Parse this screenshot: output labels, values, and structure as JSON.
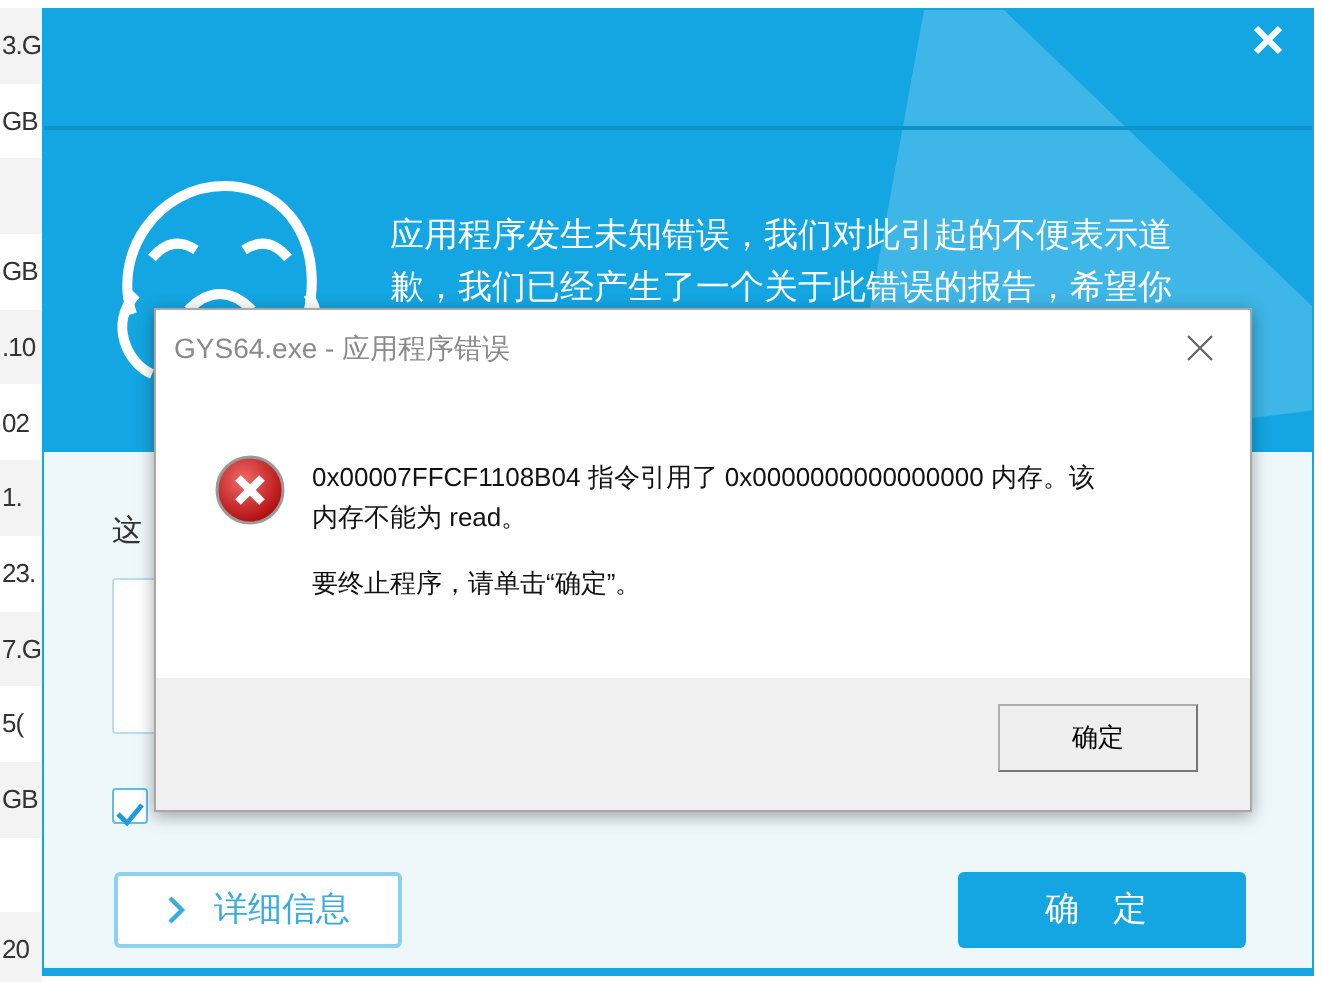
{
  "background_list": {
    "rows": [
      "3.G",
      "GB",
      "",
      "GB",
      ".10",
      "02",
      "1.",
      "23.",
      "7.G",
      "5(",
      "GB",
      "",
      "20"
    ]
  },
  "report_window": {
    "message_lines": [
      "应用程序发生未知错误，我们对此引起的不便表示道",
      "歉，我们已经产生了一个关于此错误的报告，希望你"
    ],
    "prompt": "这",
    "checkbox": {
      "checked": true
    },
    "buttons": [
      {
        "label": "详细信息",
        "kind": "details"
      },
      {
        "label": "确 定",
        "kind": "primary"
      }
    ]
  },
  "error_dialog": {
    "title": "GYS64.exe - 应用程序错误",
    "message_lines": [
      "0x00007FFCF1108B04 指令引用了 0x0000000000000000 内存。该",
      "内存不能为 read。"
    ],
    "instruction": "要终止程序，请单击“确定”。",
    "button": "确定"
  }
}
